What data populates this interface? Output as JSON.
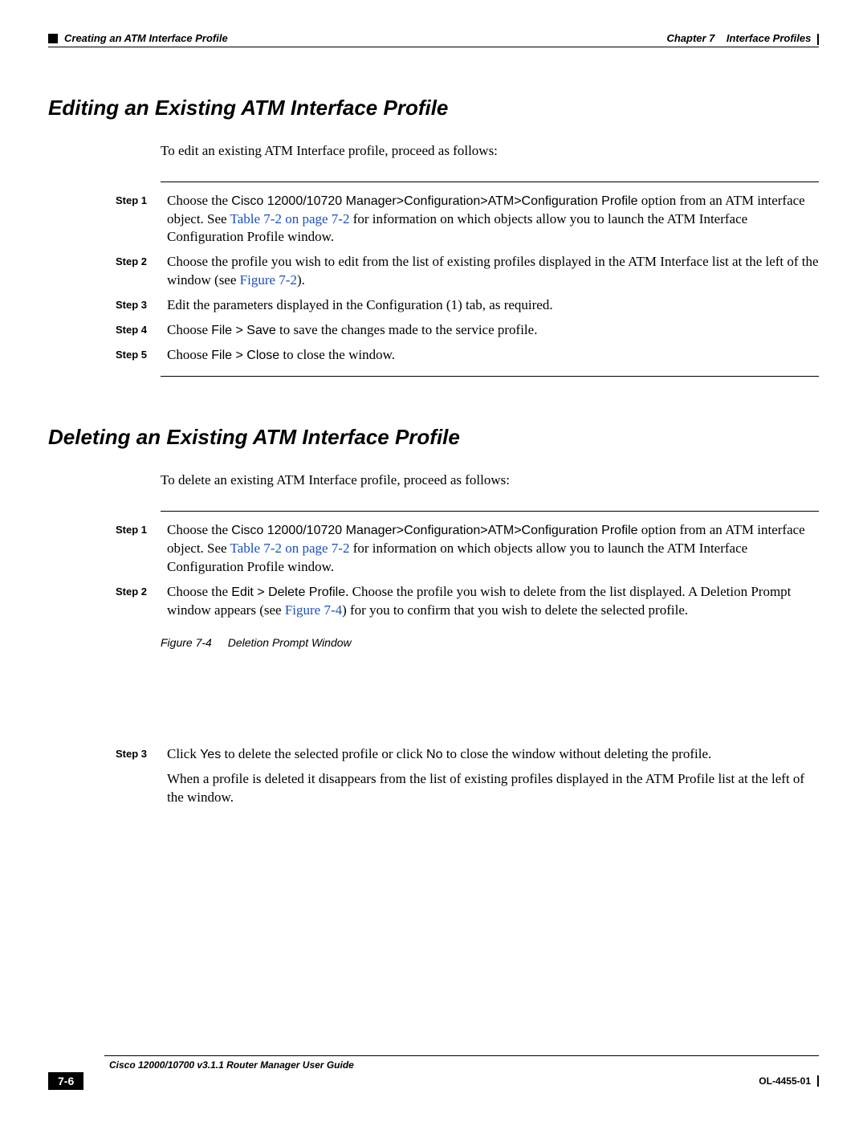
{
  "header": {
    "left": "Creating an ATM Interface Profile",
    "chapter": "Chapter 7",
    "chapterTitle": "Interface Profiles"
  },
  "section1": {
    "heading": "Editing an Existing ATM Interface Profile",
    "intro": "To edit an existing ATM Interface profile, proceed as follows:",
    "steps": [
      {
        "label": "Step 1",
        "pre": "Choose the ",
        "sans1": "Cisco 12000/10720 Manager>Configuration>ATM>Configuration Profile",
        "mid1": " option from an ATM interface object. See ",
        "link": "Table 7-2 on page 7-2",
        "post": " for information on which objects allow you to launch the ATM Interface Configuration Profile window."
      },
      {
        "label": "Step 2",
        "pre": "Choose the profile you wish to edit from the list of existing profiles displayed in the ATM Interface list at the left of the window (see ",
        "link": "Figure 7-2",
        "post": ")."
      },
      {
        "label": "Step 3",
        "text": "Edit the parameters displayed in the Configuration (1) tab, as required."
      },
      {
        "label": "Step 4",
        "pre": "Choose ",
        "sans1": "File > Save",
        "post": " to save the changes made to the service profile."
      },
      {
        "label": "Step 5",
        "pre": "Choose ",
        "sans1": "File > Close",
        "post": " to close the window."
      }
    ]
  },
  "section2": {
    "heading": "Deleting an Existing ATM Interface Profile",
    "intro": "To delete an existing ATM Interface profile, proceed as follows:",
    "steps": [
      {
        "label": "Step 1",
        "pre": "Choose the ",
        "sans1": "Cisco 12000/10720 Manager>Configuration>ATM>Configuration Profile",
        "mid1": " option from an ATM interface object. See ",
        "link": "Table 7-2 on page 7-2",
        "post": " for information on which objects allow you to launch the ATM Interface Configuration Profile window."
      },
      {
        "label": "Step 2",
        "pre": "Choose the ",
        "sans1": "Edit > Delete Profile",
        "mid1": ". Choose the profile you wish to delete from the list displayed. A Deletion Prompt window appears (see ",
        "link": "Figure 7-4",
        "post": ") for you to confirm that you wish to delete the selected profile."
      }
    ],
    "figure": {
      "num": "Figure 7-4",
      "title": "Deletion Prompt Window"
    },
    "step3": {
      "label": "Step 3",
      "pre": "Click ",
      "sans1": "Yes",
      "mid1": " to delete the selected profile or click ",
      "sans2": "No",
      "post": " to close the window without deleting the profile."
    },
    "continuation": "When a profile is deleted it disappears from the list of existing profiles displayed in the ATM Profile list at the left of the window."
  },
  "footer": {
    "guide": "Cisco 12000/10700 v3.1.1 Router Manager User Guide",
    "page": "7-6",
    "docid": "OL-4455-01"
  }
}
